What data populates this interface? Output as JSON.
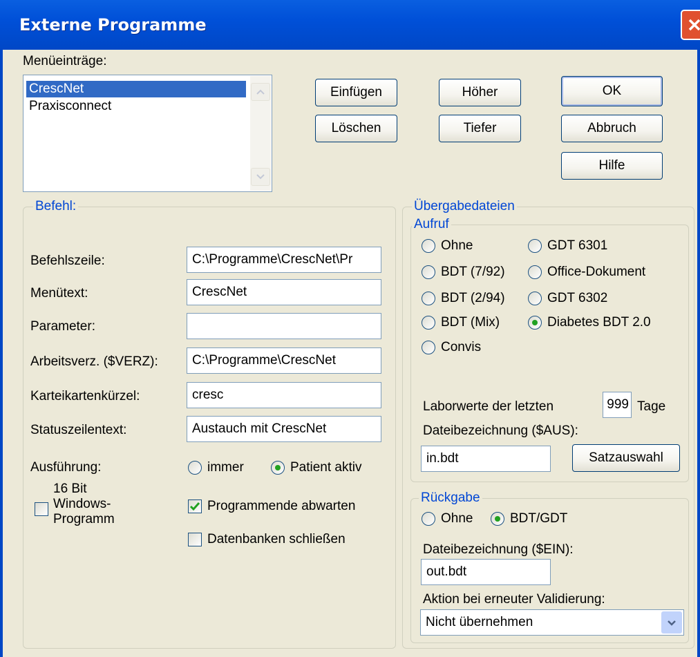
{
  "window": {
    "title": "Externe Programme"
  },
  "menu_entries": {
    "label": "Menüeinträge:",
    "items": [
      "CrescNet",
      "Praxisconnect"
    ],
    "selected_index": 0
  },
  "buttons": {
    "insert": "Einfügen",
    "delete": "Löschen",
    "up": "Höher",
    "down": "Tiefer",
    "ok": "OK",
    "cancel": "Abbruch",
    "help": "Hilfe"
  },
  "befehl": {
    "legend": "Befehl:",
    "command_line_label": "Befehlszeile:",
    "command_line_value": "C:\\Programme\\CrescNet\\Pr",
    "menu_text_label": "Menütext:",
    "menu_text_value": "CrescNet",
    "parameter_label": "Parameter:",
    "parameter_value": "",
    "work_dir_label": "Arbeitsverz. ($VERZ):",
    "work_dir_value": "C:\\Programme\\CrescNet",
    "card_short_label": "Karteikartenkürzel:",
    "card_short_value": "cresc",
    "status_text_label": "Statuszeilentext:",
    "status_text_value": "Austauch mit CrescNet",
    "execution_label": "Ausführung:",
    "execution_options": [
      "immer",
      "Patient aktiv"
    ],
    "execution_selected": "Patient aktiv",
    "bit16_label_1": "16 Bit",
    "bit16_label_2": "Windows-",
    "bit16_label_3": "Programm",
    "bit16_checked": false,
    "wait_end_label": "Programmende abwarten",
    "wait_end_checked": true,
    "close_db_label": "Datenbanken schließen",
    "close_db_checked": false
  },
  "transfer": {
    "legend": "Übergabedateien",
    "aufruf": {
      "legend": "Aufruf",
      "options": [
        "Ohne",
        "BDT (7/92)",
        "BDT (2/94)",
        "BDT (Mix)",
        "Convis",
        "GDT 6301",
        "Office-Dokument",
        "GDT 6302",
        "Diabetes BDT 2.0"
      ],
      "selected": "Diabetes BDT 2.0",
      "lab_label": "Laborwerte der letzten",
      "lab_days": "999",
      "lab_unit": "Tage",
      "file_label": "Dateibezeichnung ($AUS):",
      "file_value": "in.bdt",
      "select_button": "Satzauswahl"
    },
    "rueckgabe": {
      "legend": "Rückgabe",
      "options": [
        "Ohne",
        "BDT/GDT"
      ],
      "selected": "BDT/GDT",
      "file_label": "Dateibezeichnung ($EIN):",
      "file_value": "out.bdt",
      "action_label": "Aktion bei erneuter Validierung:",
      "action_value": "Nicht übernehmen"
    }
  },
  "colors": {
    "title_bar": "#0050d8",
    "accent_label": "#0046d5",
    "selection": "#316ac5",
    "dialog_bg": "#ece9d8"
  }
}
